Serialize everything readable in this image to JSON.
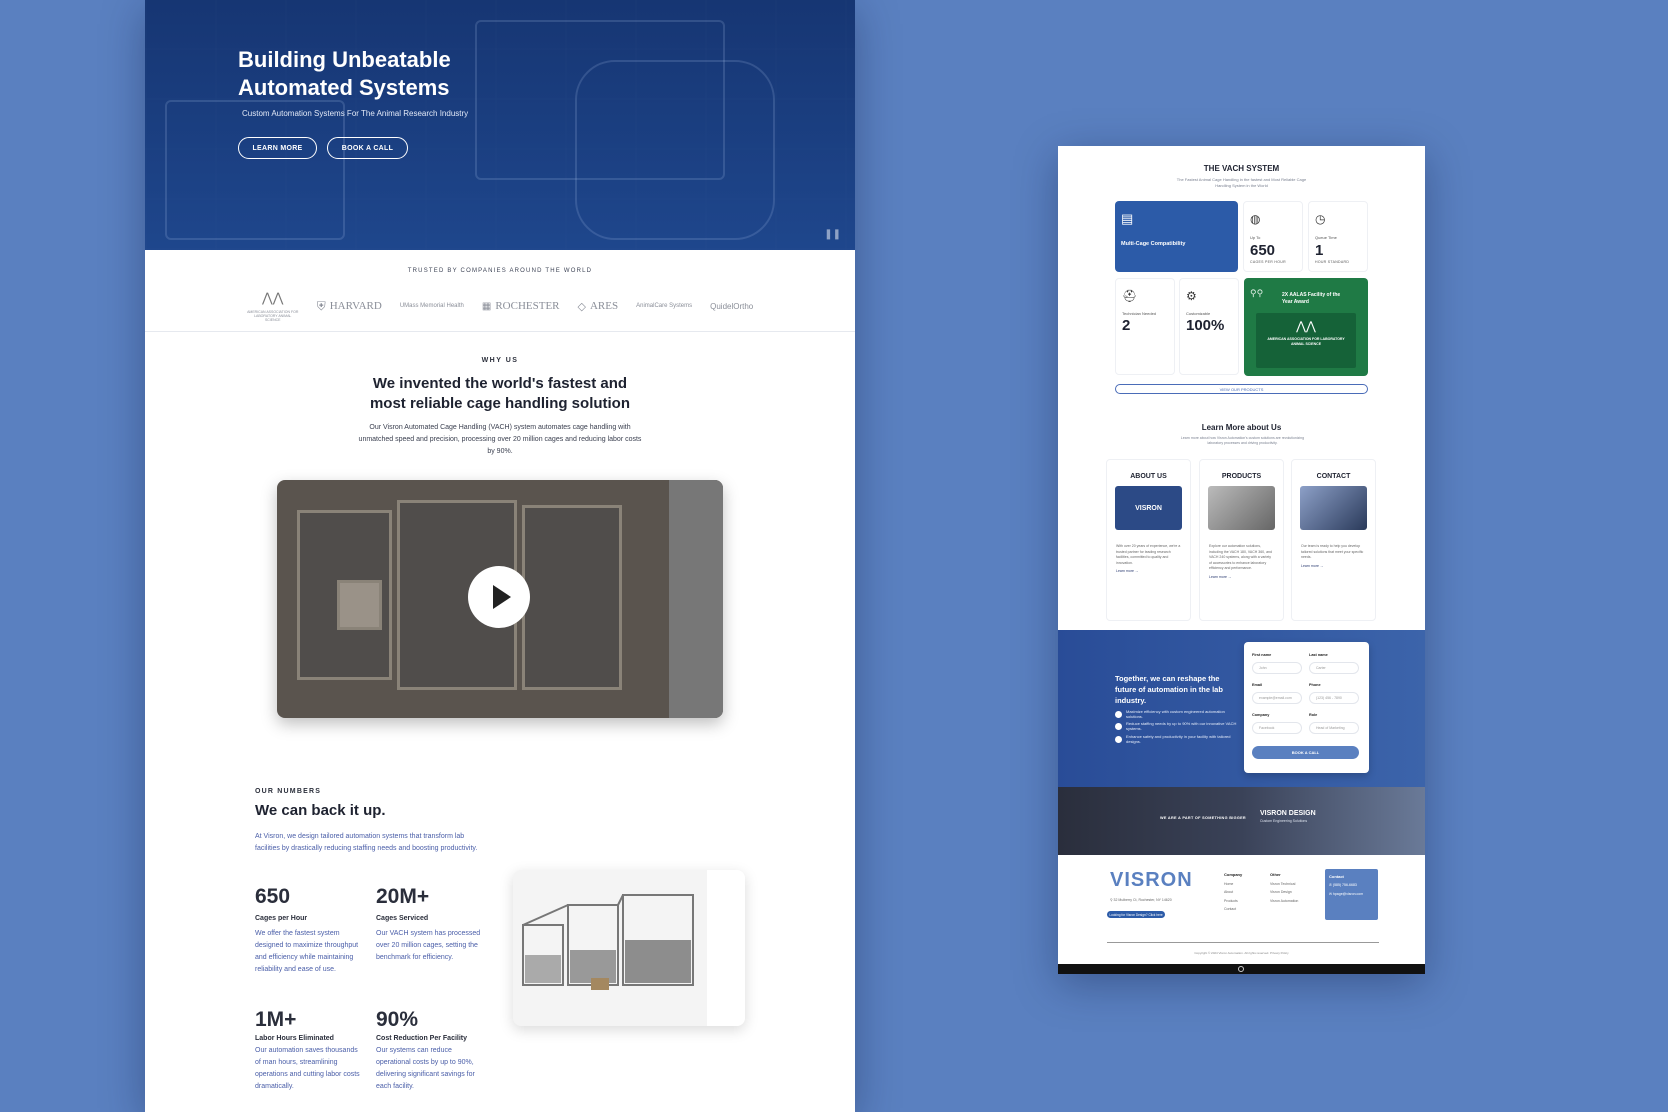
{
  "left": {
    "hero": {
      "title_line1": "Building Unbeatable",
      "title_line2": "Automated Systems",
      "subtitle": "Custom Automation Systems For The Animal Research Industry",
      "btn_learn": "LEARN MORE",
      "btn_book": "BOOK A CALL",
      "pause_icon": "pause-icon"
    },
    "trusted": {
      "label": "TRUSTED BY COMPANIES AROUND THE WORLD",
      "logos": [
        "AMERICAN ASSOCIATION FOR LABORATORY ANIMAL SCIENCE",
        "HARVARD",
        "UMass Memorial Health",
        "ROCHESTER",
        "ARES",
        "AnimalCare Systems",
        "QuidelOrtho"
      ]
    },
    "why": {
      "eyebrow": "WHY US",
      "heading_line1": "We invented the world's fastest and",
      "heading_line2": "most reliable cage handling solution",
      "body": "Our Visron Automated Cage Handling (VACH) system automates cage handling with unmatched speed and precision, processing over 20 million cages and reducing labor costs by 90%."
    },
    "numbers": {
      "eyebrow": "OUR NUMBERS",
      "heading": "We can back it up.",
      "desc": "At Visron, we design tailored automation systems that transform lab facilities by drastically reducing staffing needs and boosting productivity.",
      "stats": [
        {
          "num": "650",
          "title": "Cages per Hour",
          "text": "We offer the fastest system designed to maximize throughput and efficiency while maintaining reliability and ease of use."
        },
        {
          "num": "20M+",
          "title": "Cages Serviced",
          "text": "Our VACH system has processed over 20 million cages, setting the benchmark for efficiency."
        },
        {
          "num": "1M+",
          "title": "Labor Hours Eliminated",
          "text": "Our automation saves thousands of man hours, streamlining operations and cutting labor costs dramatically."
        },
        {
          "num": "90%",
          "title": "Cost Reduction Per Facility",
          "text": "Our systems can reduce operational costs by up to 90%, delivering significant savings for each facility."
        }
      ]
    }
  },
  "right": {
    "vach": {
      "title": "THE VACH SYSTEM",
      "sub": "The Fastest Animal Cage Handling in the fastest and Most Reliable Cage Handling System in the World",
      "multi": "Multi-Cage Compatibility",
      "t1_lbl": "Up To",
      "t1_big": "650",
      "t1_cap": "CAGES PER HOUR",
      "t2_lbl": "Queue Time",
      "t2_big": "1",
      "t2_cap": "HOUR STANDARD",
      "t3_lbl": "Technician Needed",
      "t3_big": "2",
      "t4_lbl": "Customizable",
      "t4_big": "100%",
      "award": "2X AALAS Facility of the Year Award",
      "award_org": "AMERICAN ASSOCIATION FOR LABORATORY ANIMAL SCIENCE",
      "view_btn": "VIEW OUR PRODUCTS"
    },
    "learn": {
      "title": "Learn More about Us",
      "sub": "Learn more about how Visron Automation's custom solutions are revolutionizing laboratory processes and driving productivity.",
      "cards": [
        {
          "h": "ABOUT US",
          "img_text": "VISRON",
          "t": "With over 20 years of experience, we're a trusted partner for leading research facilities, committed to quality and innovation.",
          "lm": "Learn more →"
        },
        {
          "h": "PRODUCTS",
          "img_text": "",
          "t": "Explore our automation solutions, including the VACH 180, VACH 360, and VACH 240 systems, along with a variety of accessories to enhance laboratory efficiency and performance.",
          "lm": "Learn more →"
        },
        {
          "h": "CONTACT",
          "img_text": "",
          "t": "Our team is ready to help you develop tailored solutions that meet your specific needs.",
          "lm": "Learn more →"
        }
      ]
    },
    "cta": {
      "heading": "Together, we can reshape the future of automation in the lab industry.",
      "bullets": [
        "Maximize efficiency with custom engineered automation solutions.",
        "Reduce staffing needs by up to 90% with our innovative VACH systems.",
        "Enhance safety and productivity in your facility with tailored designs."
      ],
      "form": {
        "first_label": "First name",
        "first_ph": "John",
        "last_label": "Last name",
        "last_ph": "Carter",
        "email_label": "Email",
        "email_ph": "example@email.com",
        "phone_label": "Phone",
        "phone_ph": "(123) 456 - 7890",
        "company_label": "Company",
        "company_ph": "Facebook",
        "role_label": "Role",
        "role_ph": "Head of Marketing",
        "submit": "BOOK A CALL"
      }
    },
    "band": {
      "left": "WE ARE A PART OF SOMETHING BIGGER",
      "right": "VISRON DESIGN",
      "right_sub": "Custom Engineering Solutions"
    },
    "footer": {
      "logo": "VISRON",
      "address": "32 Mulberry Ct, Rochester, NY 14620",
      "btn": "Looking for Visron Design? Click here",
      "company_h": "Company",
      "company_items": [
        "Home",
        "About",
        "Products",
        "Contact"
      ],
      "other_h": "Other",
      "other_items": [
        "Visron Technical",
        "Visron Design",
        "Visron Automation"
      ],
      "contact_h": "Contact",
      "phone": "(585) 756-6683",
      "email": "hpage@visron.com",
      "copyright": "Copyright © 2024 Visron Automation. All rights reserved. Privacy Policy"
    }
  },
  "colors": {
    "page_bg": "#5a80c0",
    "brand_blue": "#2c5ba8",
    "award_green": "#1f7a45"
  }
}
